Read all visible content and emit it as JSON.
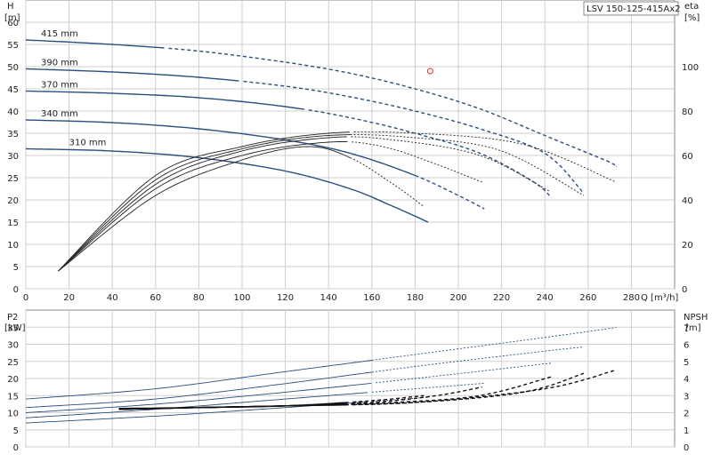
{
  "title_box": "LSV 150-125-415Ax2",
  "top": {
    "y_left_label": "H",
    "y_left_unit": "[m]",
    "y_right_label": "eta",
    "y_right_unit": "[%]",
    "x_label": "Q [m³/h]",
    "x_ticks": [
      0,
      20,
      40,
      60,
      80,
      100,
      120,
      140,
      160,
      180,
      200,
      220,
      240,
      260,
      280
    ],
    "y_left_ticks": [
      0,
      5,
      10,
      15,
      20,
      25,
      30,
      35,
      40,
      45,
      50,
      55,
      60
    ],
    "y_right_ticks": [
      0,
      20,
      40,
      60,
      80,
      100
    ]
  },
  "bottom": {
    "y_left_label": "P2",
    "y_left_unit": "[kW]",
    "y_right_label": "NPSH",
    "y_right_unit": "[m]",
    "y_left_ticks": [
      0,
      5,
      10,
      15,
      20,
      25,
      30,
      35
    ],
    "y_right_ticks": [
      0,
      1,
      2,
      3,
      4,
      5,
      6,
      7
    ]
  },
  "chart_data": [
    {
      "type": "line",
      "title": "LSV 150-125-415Ax2",
      "xlabel": "Q [m³/h]",
      "ylabel": "H [m]",
      "y2label": "eta [%]",
      "xlim": [
        0,
        300
      ],
      "ylim": [
        0,
        65
      ],
      "y2lim": [
        0,
        130
      ],
      "grid": true,
      "operating_point": {
        "x": 187,
        "y": 49
      },
      "series": [
        {
          "name": "415 mm",
          "kind": "head",
          "x": [
            0,
            40,
            80,
            120,
            150,
            180,
            210,
            240,
            270,
            273
          ],
          "y": [
            56,
            55,
            53.5,
            51,
            48.5,
            45,
            40.5,
            34.5,
            28.5,
            27.5
          ],
          "solid_until": 65
        },
        {
          "name": "390 mm",
          "kind": "head",
          "x": [
            0,
            40,
            80,
            120,
            150,
            180,
            210,
            240,
            258
          ],
          "y": [
            49.5,
            48.8,
            47.6,
            45.6,
            43.2,
            40,
            36,
            30.5,
            21.5
          ],
          "solid_until": 100
        },
        {
          "name": "370 mm",
          "kind": "head",
          "x": [
            0,
            40,
            80,
            120,
            150,
            180,
            210,
            235,
            243
          ],
          "y": [
            44.5,
            44,
            43,
            41,
            38.5,
            35,
            30.5,
            24,
            20.5
          ],
          "solid_until": 130
        },
        {
          "name": "340 mm",
          "kind": "head",
          "x": [
            0,
            40,
            80,
            120,
            150,
            180,
            200,
            212
          ],
          "y": [
            38,
            37.4,
            36,
            33.5,
            30.5,
            25.5,
            21,
            18
          ],
          "solid_until": 180
        },
        {
          "name": "310 mm",
          "kind": "head",
          "x": [
            0,
            40,
            80,
            120,
            150,
            170,
            186
          ],
          "y": [
            31.5,
            31,
            29.5,
            26.5,
            22.5,
            18.5,
            15
          ],
          "solid_until": 186
        },
        {
          "kind": "eff",
          "x": [
            15,
            60,
            100,
            130,
            150,
            170,
            184
          ],
          "y": [
            8,
            42,
            58,
            64,
            59,
            47,
            37
          ]
        },
        {
          "kind": "eff",
          "x": [
            15,
            60,
            100,
            140,
            165,
            190,
            211
          ],
          "y": [
            8,
            45,
            60,
            66,
            64,
            56,
            48
          ]
        },
        {
          "kind": "eff",
          "x": [
            15,
            60,
            100,
            140,
            170,
            210,
            242
          ],
          "y": [
            8,
            47,
            62,
            68,
            67,
            60,
            44
          ]
        },
        {
          "kind": "eff",
          "x": [
            15,
            60,
            100,
            140,
            180,
            220,
            258
          ],
          "y": [
            8,
            49,
            63,
            69,
            68,
            62,
            42
          ]
        },
        {
          "kind": "eff",
          "x": [
            15,
            60,
            100,
            140,
            180,
            230,
            273
          ],
          "y": [
            8,
            51,
            64,
            70,
            70,
            65,
            48
          ]
        }
      ]
    },
    {
      "type": "line",
      "xlabel": "Q [m³/h]",
      "ylabel": "P2 [kW]",
      "y2label": "NPSH [m]",
      "xlim": [
        0,
        300
      ],
      "ylim": [
        0,
        40
      ],
      "y2lim": [
        0,
        8
      ],
      "grid": true,
      "series": [
        {
          "kind": "power",
          "x": [
            0,
            60,
            120,
            180,
            240,
            273
          ],
          "y": [
            14,
            17,
            22,
            27,
            32,
            34.9
          ]
        },
        {
          "kind": "power",
          "x": [
            0,
            60,
            120,
            180,
            240,
            258
          ],
          "y": [
            11.5,
            14,
            18.5,
            23.5,
            28,
            29.2
          ]
        },
        {
          "kind": "power",
          "x": [
            0,
            60,
            120,
            180,
            243
          ],
          "y": [
            10,
            12.5,
            16,
            20,
            24.5
          ]
        },
        {
          "kind": "power",
          "x": [
            0,
            60,
            120,
            180,
            212
          ],
          "y": [
            8.5,
            11,
            14,
            17,
            18.6
          ]
        },
        {
          "kind": "power",
          "x": [
            0,
            60,
            120,
            186
          ],
          "y": [
            7,
            9,
            11.5,
            14.5
          ]
        },
        {
          "kind": "npsh",
          "x": [
            43,
            80,
            120,
            160,
            184
          ],
          "y": [
            2.25,
            2.3,
            2.4,
            2.7,
            3.0
          ]
        },
        {
          "kind": "npsh",
          "x": [
            43,
            80,
            120,
            160,
            190,
            211
          ],
          "y": [
            2.2,
            2.3,
            2.4,
            2.6,
            3.0,
            3.5
          ]
        },
        {
          "kind": "npsh",
          "x": [
            43,
            80,
            120,
            170,
            210,
            243
          ],
          "y": [
            2.2,
            2.3,
            2.4,
            2.6,
            3.0,
            4.1
          ]
        },
        {
          "kind": "npsh",
          "x": [
            43,
            80,
            120,
            180,
            230,
            258
          ],
          "y": [
            2.2,
            2.3,
            2.4,
            2.6,
            3.2,
            4.3
          ]
        },
        {
          "kind": "npsh",
          "x": [
            43,
            80,
            120,
            180,
            240,
            273
          ],
          "y": [
            2.2,
            2.3,
            2.4,
            2.6,
            3.4,
            4.5
          ]
        }
      ]
    }
  ]
}
